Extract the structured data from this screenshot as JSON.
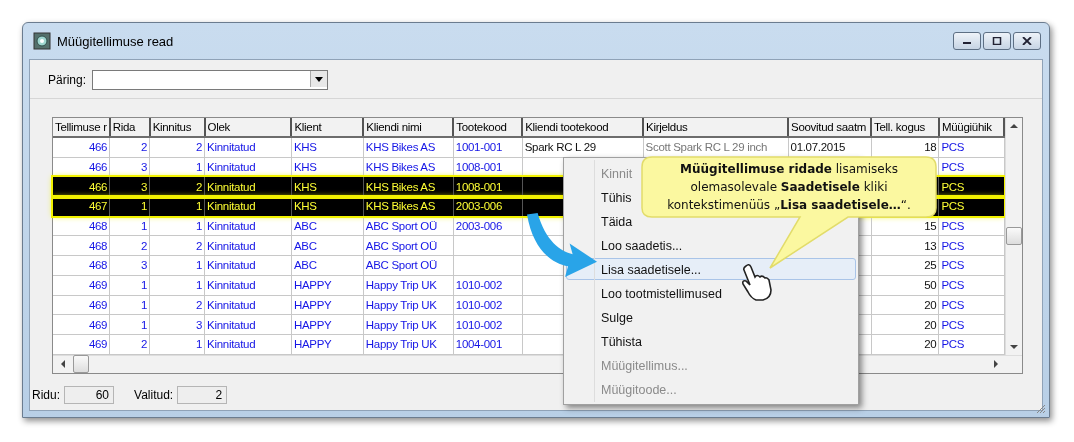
{
  "window": {
    "title": "Müügitellimuse read"
  },
  "query": {
    "label": "Päring:"
  },
  "table": {
    "columns": [
      "Tellimuse r",
      "Rida",
      "Kinnitus",
      "Olek",
      "Klient",
      "Kliendi nimi",
      "Tootekood",
      "Kliendi tootekood",
      "Kirjeldus",
      "Soovitud saatm",
      "Tell. kogus",
      "Müügiühik"
    ],
    "rows": [
      {
        "selected": false,
        "cells": [
          "466",
          "2",
          "2",
          "Kinnitatud",
          "KHS",
          "KHS Bikes AS",
          "1001-001",
          "Spark RC L 29",
          "Scott Spark RC L 29 inch",
          "01.07.2015",
          "18",
          "PCS"
        ]
      },
      {
        "selected": false,
        "cells": [
          "466",
          "3",
          "1",
          "Kinnitatud",
          "KHS",
          "KHS Bikes AS",
          "1008-001",
          null,
          null,
          null,
          null,
          "PCS"
        ]
      },
      {
        "selected": true,
        "cells": [
          "466",
          "3",
          "2",
          "Kinnitatud",
          "KHS",
          "KHS Bikes AS",
          "1008-001",
          null,
          null,
          null,
          null,
          "PCS"
        ]
      },
      {
        "selected": true,
        "cells": [
          "467",
          "1",
          "1",
          "Kinnitatud",
          "KHS",
          "KHS Bikes AS",
          "2003-006",
          null,
          null,
          null,
          null,
          "PCS"
        ]
      },
      {
        "selected": false,
        "cells": [
          "468",
          "1",
          "1",
          "Kinnitatud",
          "ABC",
          "ABC Sport OÜ",
          "2003-006",
          null,
          null,
          null,
          "15",
          "PCS"
        ]
      },
      {
        "selected": false,
        "cells": [
          "468",
          "2",
          "2",
          "Kinnitatud",
          "ABC",
          "ABC Sport OÜ",
          null,
          null,
          null,
          null,
          "13",
          "PCS"
        ]
      },
      {
        "selected": false,
        "cells": [
          "468",
          "3",
          "1",
          "Kinnitatud",
          "ABC",
          "ABC Sport OÜ",
          null,
          null,
          null,
          null,
          "25",
          "PCS"
        ]
      },
      {
        "selected": false,
        "cells": [
          "469",
          "1",
          "1",
          "Kinnitatud",
          "HAPPY",
          "Happy Trip UK",
          "1010-002",
          null,
          null,
          null,
          "50",
          "PCS"
        ]
      },
      {
        "selected": false,
        "cells": [
          "469",
          "1",
          "2",
          "Kinnitatud",
          "HAPPY",
          "Happy Trip UK",
          "1010-002",
          null,
          null,
          null,
          "20",
          "PCS"
        ]
      },
      {
        "selected": false,
        "cells": [
          "469",
          "1",
          "3",
          "Kinnitatud",
          "HAPPY",
          "Happy Trip UK",
          "1010-002",
          null,
          null,
          null,
          "20",
          "PCS"
        ]
      },
      {
        "selected": false,
        "cells": [
          "469",
          "2",
          "1",
          "Kinnitatud",
          "HAPPY",
          "Happy Trip UK",
          "1004-001",
          null,
          null,
          null,
          "20",
          "PCS"
        ]
      }
    ]
  },
  "status_bar": [
    {
      "label": "Ridu:",
      "value": "60"
    },
    {
      "label": "Valitud:",
      "value": "2"
    }
  ],
  "context_menu": [
    {
      "label": "Kinnit",
      "disabled": true,
      "selected": false
    },
    {
      "label": "Tühis",
      "disabled": false,
      "selected": false
    },
    {
      "label": "Täida",
      "disabled": false,
      "selected": false
    },
    {
      "label": "Loo saadetis...",
      "disabled": false,
      "selected": false
    },
    {
      "label": "Lisa saadetisele...",
      "disabled": false,
      "selected": true
    },
    {
      "label": "Loo tootmistellimused",
      "disabled": false,
      "selected": false
    },
    {
      "label": "Sulge",
      "disabled": false,
      "selected": false
    },
    {
      "label": "Tühista",
      "disabled": false,
      "selected": false
    },
    {
      "label": "Müügitellimus...",
      "disabled": true,
      "selected": false
    },
    {
      "label": "Müügitoode...",
      "disabled": true,
      "selected": false
    }
  ],
  "callout": {
    "text": "**Müügitellimuse ridade** lisamiseks olemasolevale **Saadetisele** kliki kontekstimenüüs „**Lisa saadetisele…**“."
  }
}
